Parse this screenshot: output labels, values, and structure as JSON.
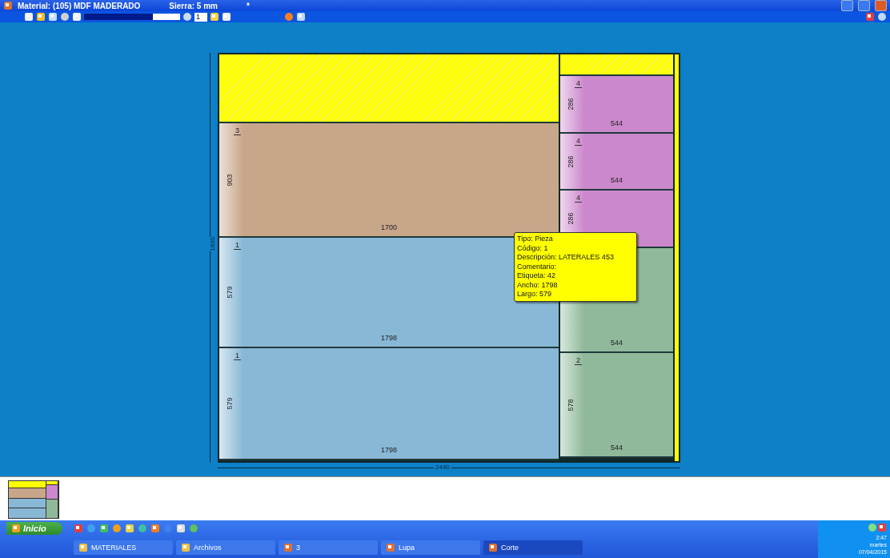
{
  "window": {
    "title": "Material: (105) MDF MADERADO",
    "saw": "Sierra: 5 mm",
    "marker": "*"
  },
  "toolbar": {
    "zoom": {
      "level": 0.72
    },
    "zoom_value": "1"
  },
  "board": {
    "height_label": "1830",
    "width_label": "2440",
    "columns": [
      {
        "pieces": [
          {
            "kind": "waste"
          },
          {
            "kind": "piece",
            "color": "#c8a68a",
            "number": "3",
            "height_label": "903",
            "width_label": "1700"
          },
          {
            "kind": "piece",
            "color": "#88b8d6",
            "number": "1",
            "height_label": "579",
            "width_label": "1798"
          },
          {
            "kind": "piece",
            "color": "#88b8d6",
            "number": "1",
            "height_label": "579",
            "width_label": "1798"
          }
        ]
      },
      {
        "pieces": [
          {
            "kind": "waste"
          },
          {
            "kind": "piece",
            "color": "#cc88cc",
            "number": "4",
            "height_label": "286",
            "width_label": "544"
          },
          {
            "kind": "piece",
            "color": "#cc88cc",
            "number": "4",
            "height_label": "286",
            "width_label": "544"
          },
          {
            "kind": "piece",
            "color": "#cc88cc",
            "number": "4",
            "height_label": "286"
          },
          {
            "kind": "piece",
            "color": "#8fb99a",
            "width_label": "544"
          },
          {
            "kind": "piece",
            "color": "#8fb99a",
            "number": "2",
            "height_label": "578",
            "width_label": "544"
          }
        ]
      }
    ]
  },
  "tooltip": {
    "lines": [
      "Tipo: Pieza",
      "Código: 1",
      "Descripción: LATERALES 453",
      "Comentario:",
      "Etiqueta: 42",
      "Ancho: 1798",
      "Largo: 579"
    ]
  },
  "taskbar": {
    "start": "Inicio",
    "tasks": [
      {
        "label": "MATERIALES",
        "selected": false
      },
      {
        "label": "Archivos",
        "selected": false
      },
      {
        "label": "3",
        "selected": false
      },
      {
        "label": "Lupa",
        "selected": false
      },
      {
        "label": "Corte",
        "selected": true
      }
    ],
    "clock": [
      "2:47",
      "martes",
      "07/04/2015"
    ]
  }
}
